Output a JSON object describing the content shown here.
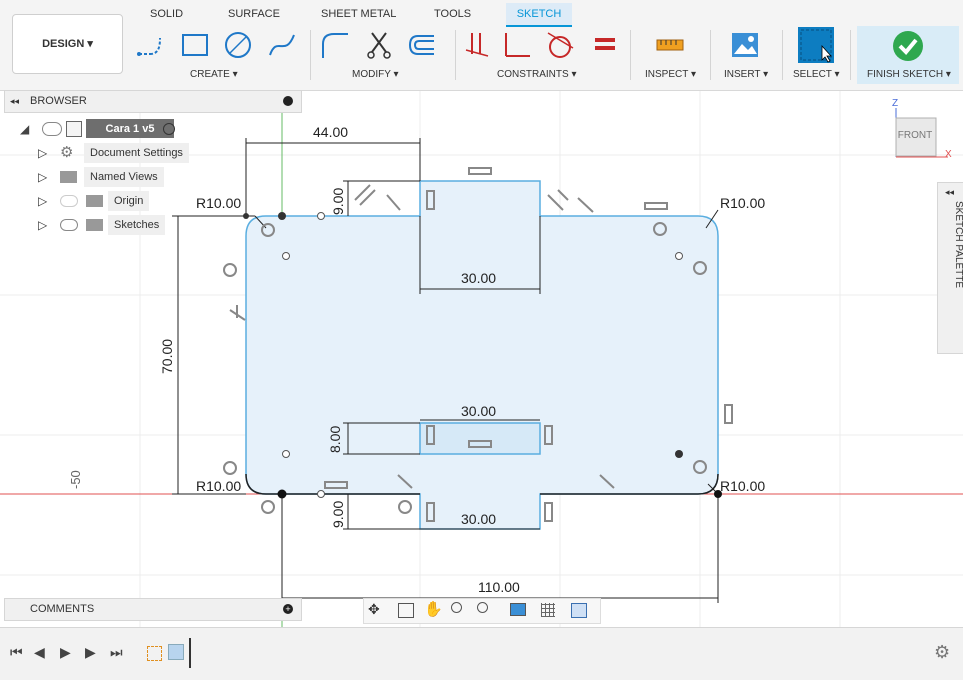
{
  "tabs": [
    "SOLID",
    "SURFACE",
    "SHEET METAL",
    "TOOLS",
    "SKETCH"
  ],
  "design_button": "DESIGN ▾",
  "groups": {
    "create": "CREATE ▾",
    "modify": "MODIFY ▾",
    "constraints": "CONSTRAINTS ▾",
    "inspect": "INSPECT ▾",
    "insert": "INSERT ▾",
    "select": "SELECT ▾",
    "finish": "FINISH SKETCH ▾"
  },
  "browser": {
    "title": "BROWSER",
    "root": "Cara 1 v5",
    "items": [
      "Document Settings",
      "Named Views",
      "Origin",
      "Sketches"
    ]
  },
  "comments": "COMMENTS",
  "sketch_palette": "SKETCH PALETTE",
  "viewcube": {
    "face": "FRONT",
    "axis_z": "Z",
    "axis_x": "X"
  },
  "dimensions": {
    "d44": "44.00",
    "d9_top": "9.00",
    "r_tl": "R10.00",
    "r_tr": "R10.00",
    "r_bl": "R10.00",
    "r_br": "R10.00",
    "d30_top": "30.00",
    "d70": "70.00",
    "d8": "8.00",
    "d30_mid": "30.00",
    "d9_bot": "9.00",
    "d30_bot": "30.00",
    "d110": "110.00",
    "axis_label": "-50"
  },
  "colors": {
    "accent": "#0696d7",
    "profile_fill": "#e6f1fa",
    "finish_green": "#2fa84f"
  }
}
